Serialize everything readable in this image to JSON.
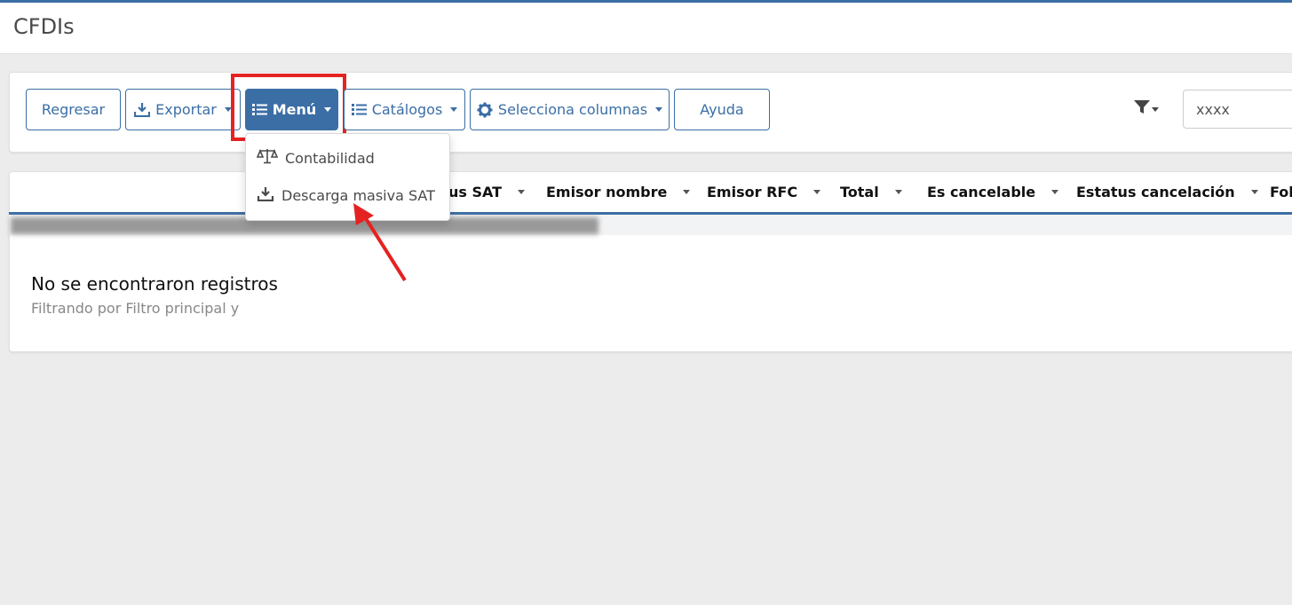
{
  "header": {
    "title": "CFDIs"
  },
  "toolbar": {
    "back_label": "Regresar",
    "export_label": "Exportar",
    "menu_label": "Menú",
    "catalogs_label": "Catálogos",
    "columns_label": "Selecciona columnas",
    "help_label": "Ayuda",
    "search_value": "xxxx"
  },
  "menu_dropdown": {
    "items": [
      {
        "label": "Contabilidad",
        "icon": "balance-scale-icon"
      },
      {
        "label": "Descarga masiva SAT",
        "icon": "download-icon"
      }
    ]
  },
  "table": {
    "columns": [
      "us SAT",
      "Emisor nombre",
      "Emisor RFC",
      "Total",
      "Es cancelable",
      "Estatus cancelación",
      "Fol"
    ],
    "empty_title": "No se encontraron registros",
    "empty_subtitle": "Filtrando por Filtro principal y"
  },
  "colors": {
    "accent": "#3b6ea5",
    "highlight": "#e52222",
    "background": "#ececec"
  }
}
